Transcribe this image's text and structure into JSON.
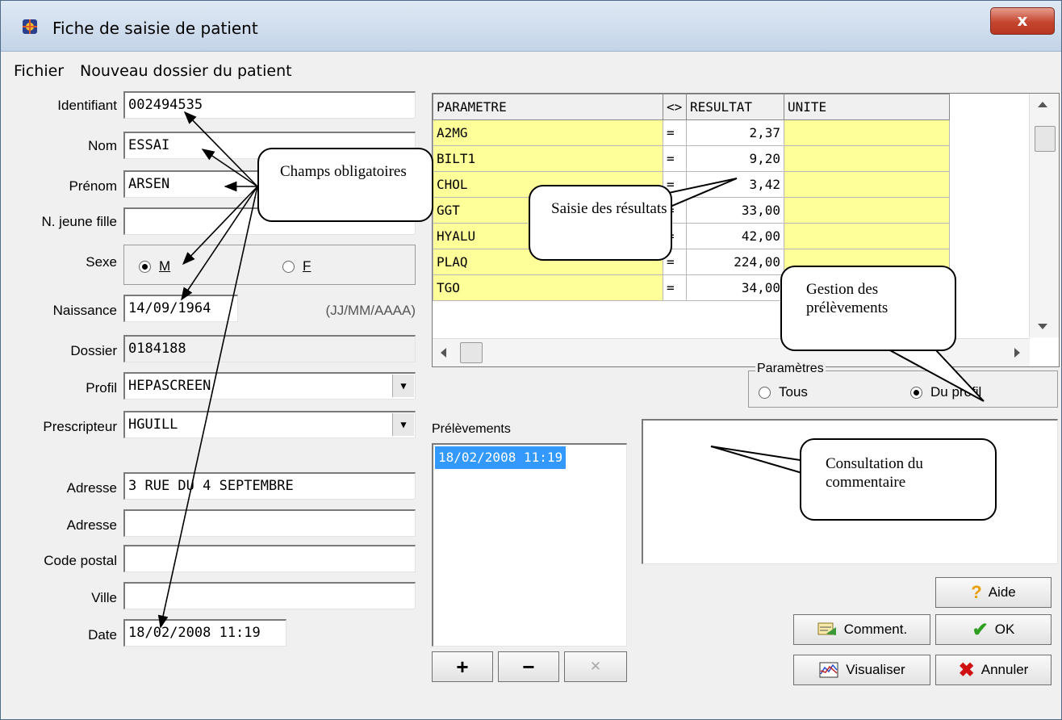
{
  "window": {
    "title": "Fiche de saisie de patient",
    "close_label": "x"
  },
  "menu": {
    "items": [
      "Fichier",
      "Nouveau dossier du patient"
    ]
  },
  "form": {
    "identifiant": {
      "label": "Identifiant",
      "value": "002494535"
    },
    "nom": {
      "label": "Nom",
      "value": "ESSAI"
    },
    "prenom": {
      "label": "Prénom",
      "value": "ARSEN"
    },
    "jeune_fille": {
      "label": "N. jeune fille",
      "value": ""
    },
    "sexe": {
      "label": "Sexe",
      "option_m": "M",
      "option_f": "F",
      "selected": "M"
    },
    "naissance": {
      "label": "Naissance",
      "value": "14/09/1964",
      "hint": "(JJ/MM/AAAA)"
    },
    "dossier": {
      "label": "Dossier",
      "value": "0184188"
    },
    "profil": {
      "label": "Profil",
      "value": "HEPASCREEN"
    },
    "prescripteur": {
      "label": "Prescripteur",
      "value": "HGUILL"
    },
    "adresse1": {
      "label": "Adresse",
      "value": "3 RUE DU 4 SEPTEMBRE"
    },
    "adresse2": {
      "label": "Adresse",
      "value": ""
    },
    "code_postal": {
      "label": "Code postal",
      "value": ""
    },
    "ville": {
      "label": "Ville",
      "value": ""
    },
    "date": {
      "label": "Date",
      "value": "18/02/2008  11:19"
    }
  },
  "grid": {
    "headers": [
      "PARAMETRE",
      "<>",
      "RESULTAT",
      "UNITE"
    ],
    "rows": [
      [
        "A2MG",
        "=",
        "2,37",
        ""
      ],
      [
        "BILT1",
        "=",
        "9,20",
        ""
      ],
      [
        "CHOL",
        "=",
        "3,42",
        ""
      ],
      [
        "GGT",
        "=",
        "33,00",
        ""
      ],
      [
        "HYALU",
        "=",
        "42,00",
        ""
      ],
      [
        "PLAQ",
        "=",
        "224,00",
        ""
      ],
      [
        "TGO",
        "=",
        "34,00",
        ""
      ]
    ]
  },
  "parametres": {
    "title": "Paramètres",
    "tous": "Tous",
    "du_profil": "Du profil",
    "selected": "Du profil"
  },
  "prelevements": {
    "label": "Prélèvements",
    "items": [
      "18/02/2008  11:19"
    ]
  },
  "buttons": {
    "aide": "Aide",
    "comment": "Comment.",
    "ok": "OK",
    "visualiser": "Visualiser",
    "annuler": "Annuler",
    "add": "+",
    "remove": "−",
    "delete": "✕"
  },
  "callouts": {
    "champs": "Champs obligatoires",
    "saisie": "Saisie des résultats",
    "gestion": "Gestion des prélèvements",
    "consultation": "Consultation du commentaire"
  },
  "colors": {
    "grid_yellow": "#ffff99",
    "selection": "#3399ff",
    "ok_check": "#2e9e1f",
    "cancel_x": "#d01010",
    "help": "#e8a000"
  }
}
